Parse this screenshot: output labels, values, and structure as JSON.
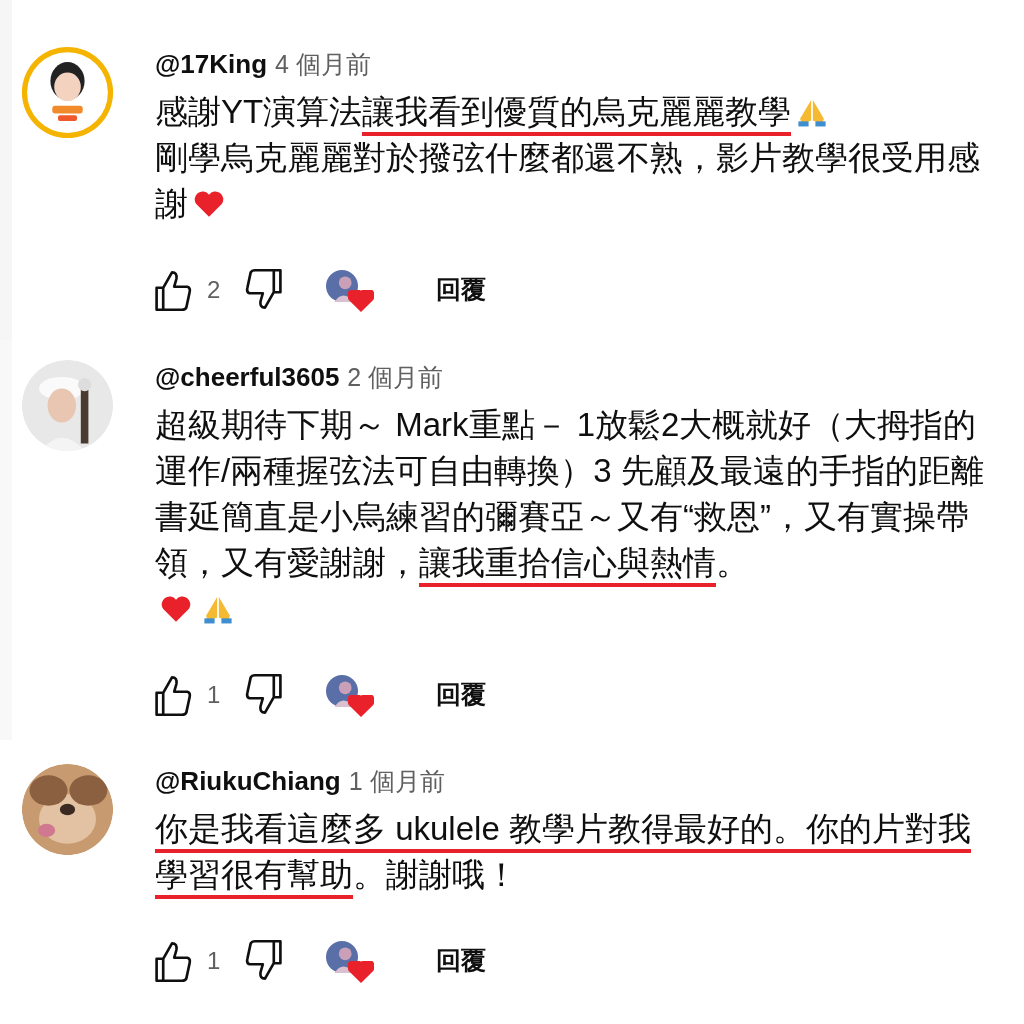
{
  "comments": [
    {
      "author": "@17King",
      "time": "4 個月前",
      "avatar": {
        "kind": "picture",
        "color": "#f4b400"
      },
      "lines": [
        [
          {
            "kind": "text",
            "text": "感謝YT演算法",
            "underlined": false
          },
          {
            "kind": "text",
            "text": "讓我看到優質的烏克麗麗教學",
            "underlined": true
          },
          {
            "kind": "pray"
          }
        ],
        [
          {
            "kind": "text",
            "text": "剛學烏克麗麗對於撥弦什麼都還不熟，影片教學很受用感",
            "underlined": false
          }
        ],
        [
          {
            "kind": "text",
            "text": "謝",
            "underlined": false
          },
          {
            "kind": "heart"
          }
        ]
      ],
      "likes": "2",
      "hearted": true,
      "reply": "回覆"
    },
    {
      "author": "@cheerful3605",
      "time": "2 個月前",
      "avatar": {
        "kind": "picture",
        "color": "#e8e8e8"
      },
      "lines": [
        [
          {
            "kind": "text",
            "text": "超級期待下期～ Mark重點－ 1放鬆2大概就好（大拇指的",
            "underlined": false
          }
        ],
        [
          {
            "kind": "text",
            "text": "運作/兩種握弦法可自由轉換）3 先顧及最遠的手指的距離",
            "underlined": false
          }
        ],
        [
          {
            "kind": "text",
            "text": "書延簡直是小烏練習的彌賽亞～又有“救恩”，又有實操帶",
            "underlined": false
          }
        ],
        [
          {
            "kind": "text",
            "text": "領，又有愛謝謝，",
            "underlined": false
          },
          {
            "kind": "text",
            "text": "讓我重拾信心與熱情",
            "underlined": true
          },
          {
            "kind": "text",
            "text": "。",
            "underlined": false
          }
        ],
        [
          {
            "kind": "heart"
          },
          {
            "kind": "pray"
          }
        ]
      ],
      "likes": "1",
      "hearted": true,
      "reply": "回覆"
    },
    {
      "author": "@RiukuChiang",
      "time": "1 個月前",
      "avatar": {
        "kind": "picture",
        "color": "#c89a70"
      },
      "lines": [
        [
          {
            "kind": "text",
            "text": "你是我看這麼多 ukulele 教學片教得最好的。你的片對我",
            "underlined": true
          }
        ],
        [
          {
            "kind": "text",
            "text": "學習很有幫助",
            "underlined": true
          },
          {
            "kind": "text",
            "text": "。謝謝哦！",
            "underlined": false
          }
        ]
      ],
      "likes": "1",
      "hearted": true,
      "reply": "回覆"
    }
  ]
}
